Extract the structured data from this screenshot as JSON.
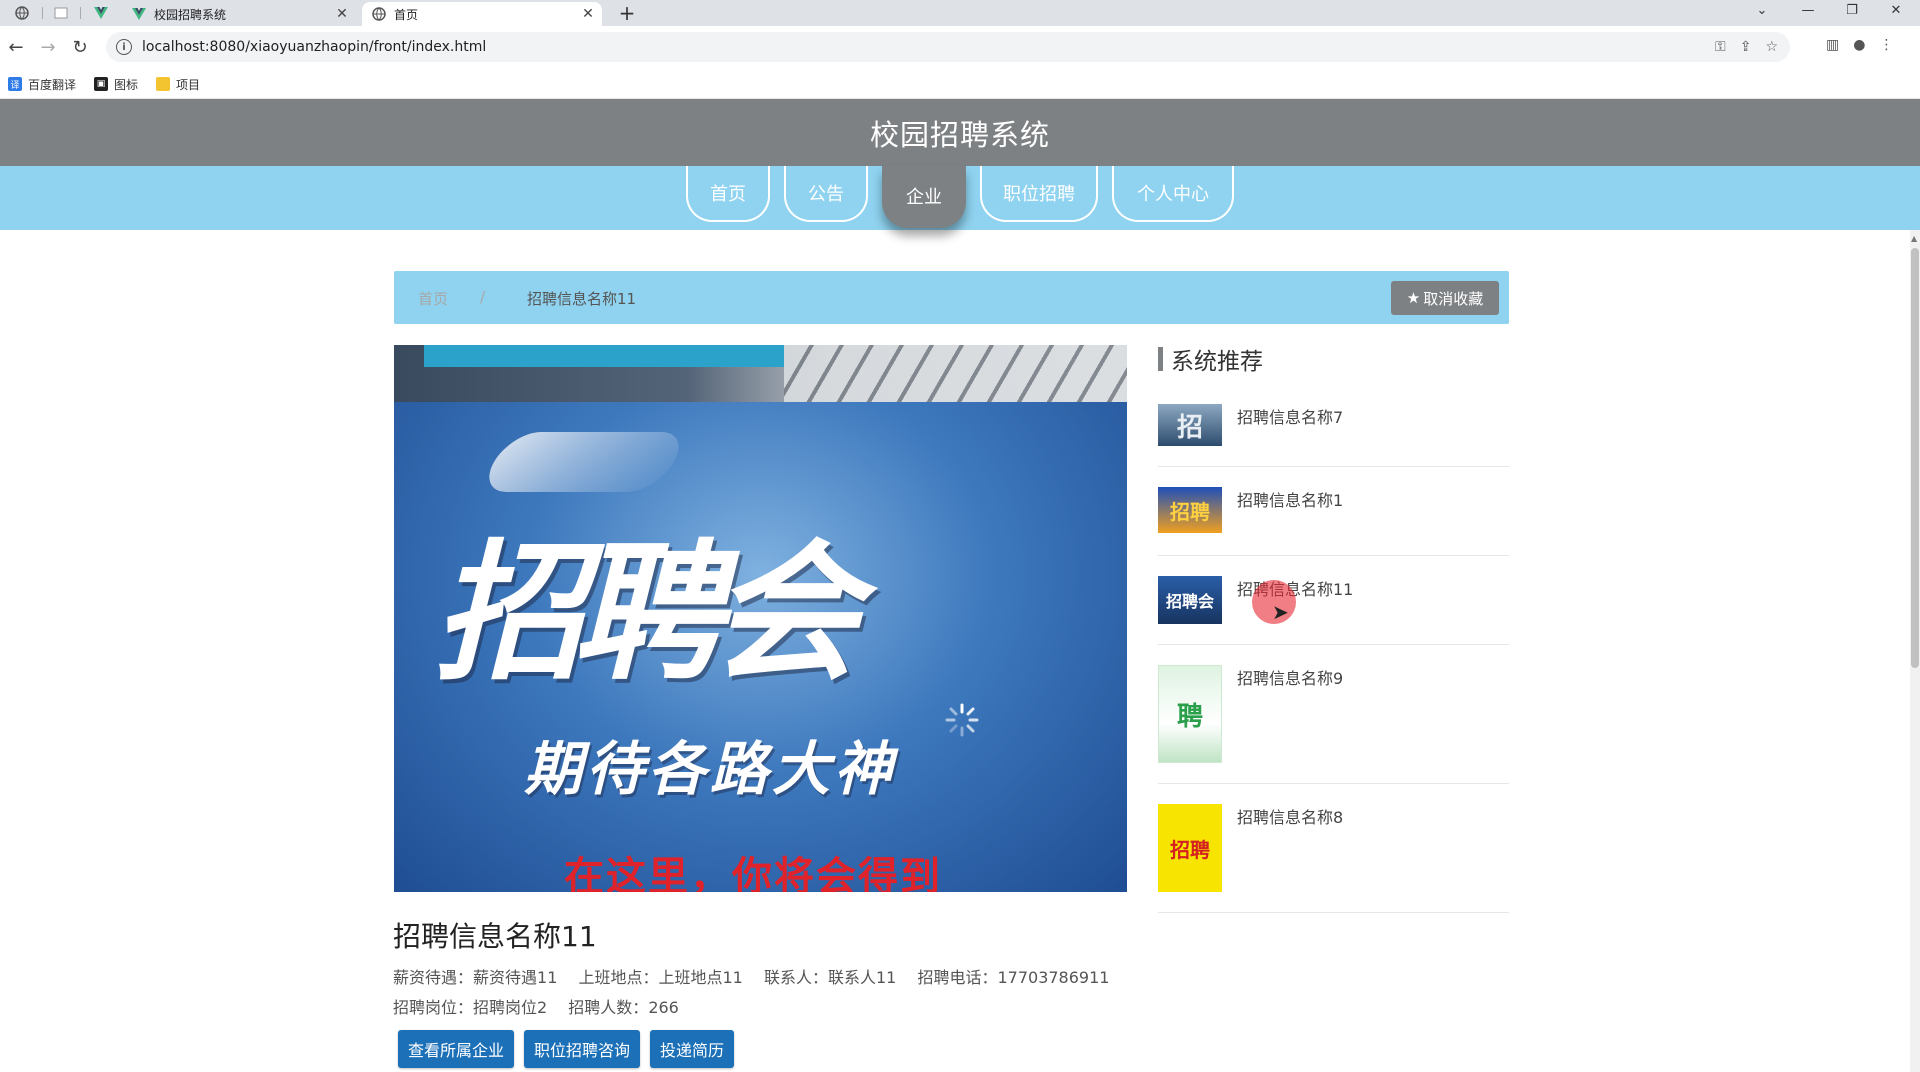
{
  "browser": {
    "tabs": [
      {
        "label": "校园招聘系统",
        "active": false
      },
      {
        "label": "首页",
        "active": true
      }
    ],
    "url": "localhost:8080/xiaoyuanzhaopin/front/index.html",
    "bookmarks": [
      "百度翻译",
      "图标",
      "项目"
    ],
    "new_tab": "+",
    "close_glyph": "✕"
  },
  "site": {
    "title": "校园招聘系统",
    "nav": [
      {
        "label": "首页",
        "active": false
      },
      {
        "label": "公告",
        "active": false
      },
      {
        "label": "企业",
        "active": true
      },
      {
        "label": "职位招聘",
        "active": false
      },
      {
        "label": "个人中心",
        "active": false
      }
    ]
  },
  "breadcrumb": {
    "home": "首页",
    "separator": "/",
    "current": "招聘信息名称11",
    "favorite_button": "取消收藏"
  },
  "poster": {
    "big_text": "招聘会",
    "sub_text": "期待各路大神",
    "red_text": "在这里，你将会得到"
  },
  "detail": {
    "title": "招聘信息名称11",
    "line1": [
      {
        "label": "薪资待遇：",
        "value": "薪资待遇11"
      },
      {
        "label": "上班地点：",
        "value": "上班地点11"
      },
      {
        "label": "联系人：",
        "value": "联系人11"
      },
      {
        "label": "招聘电话：",
        "value": "17703786911"
      }
    ],
    "line2": [
      {
        "label": "招聘岗位：",
        "value": "招聘岗位2"
      },
      {
        "label": "招聘人数：",
        "value": "266"
      }
    ],
    "buttons": [
      "查看所属企业",
      "职位招聘咨询",
      "投递简历"
    ]
  },
  "recommend": {
    "heading": "系统推荐",
    "items": [
      {
        "name": "招聘信息名称7",
        "thumb_text": "招"
      },
      {
        "name": "招聘信息名称1",
        "thumb_text": "招聘"
      },
      {
        "name": "招聘信息名称11",
        "thumb_text": "招聘会"
      },
      {
        "name": "招聘信息名称9",
        "thumb_text": "聘"
      },
      {
        "name": "招聘信息名称8",
        "thumb_text": "招聘"
      }
    ]
  },
  "colors": {
    "header_gray": "#7d8184",
    "nav_blue": "#8fd3f0",
    "button_blue": "#1c70b8"
  }
}
